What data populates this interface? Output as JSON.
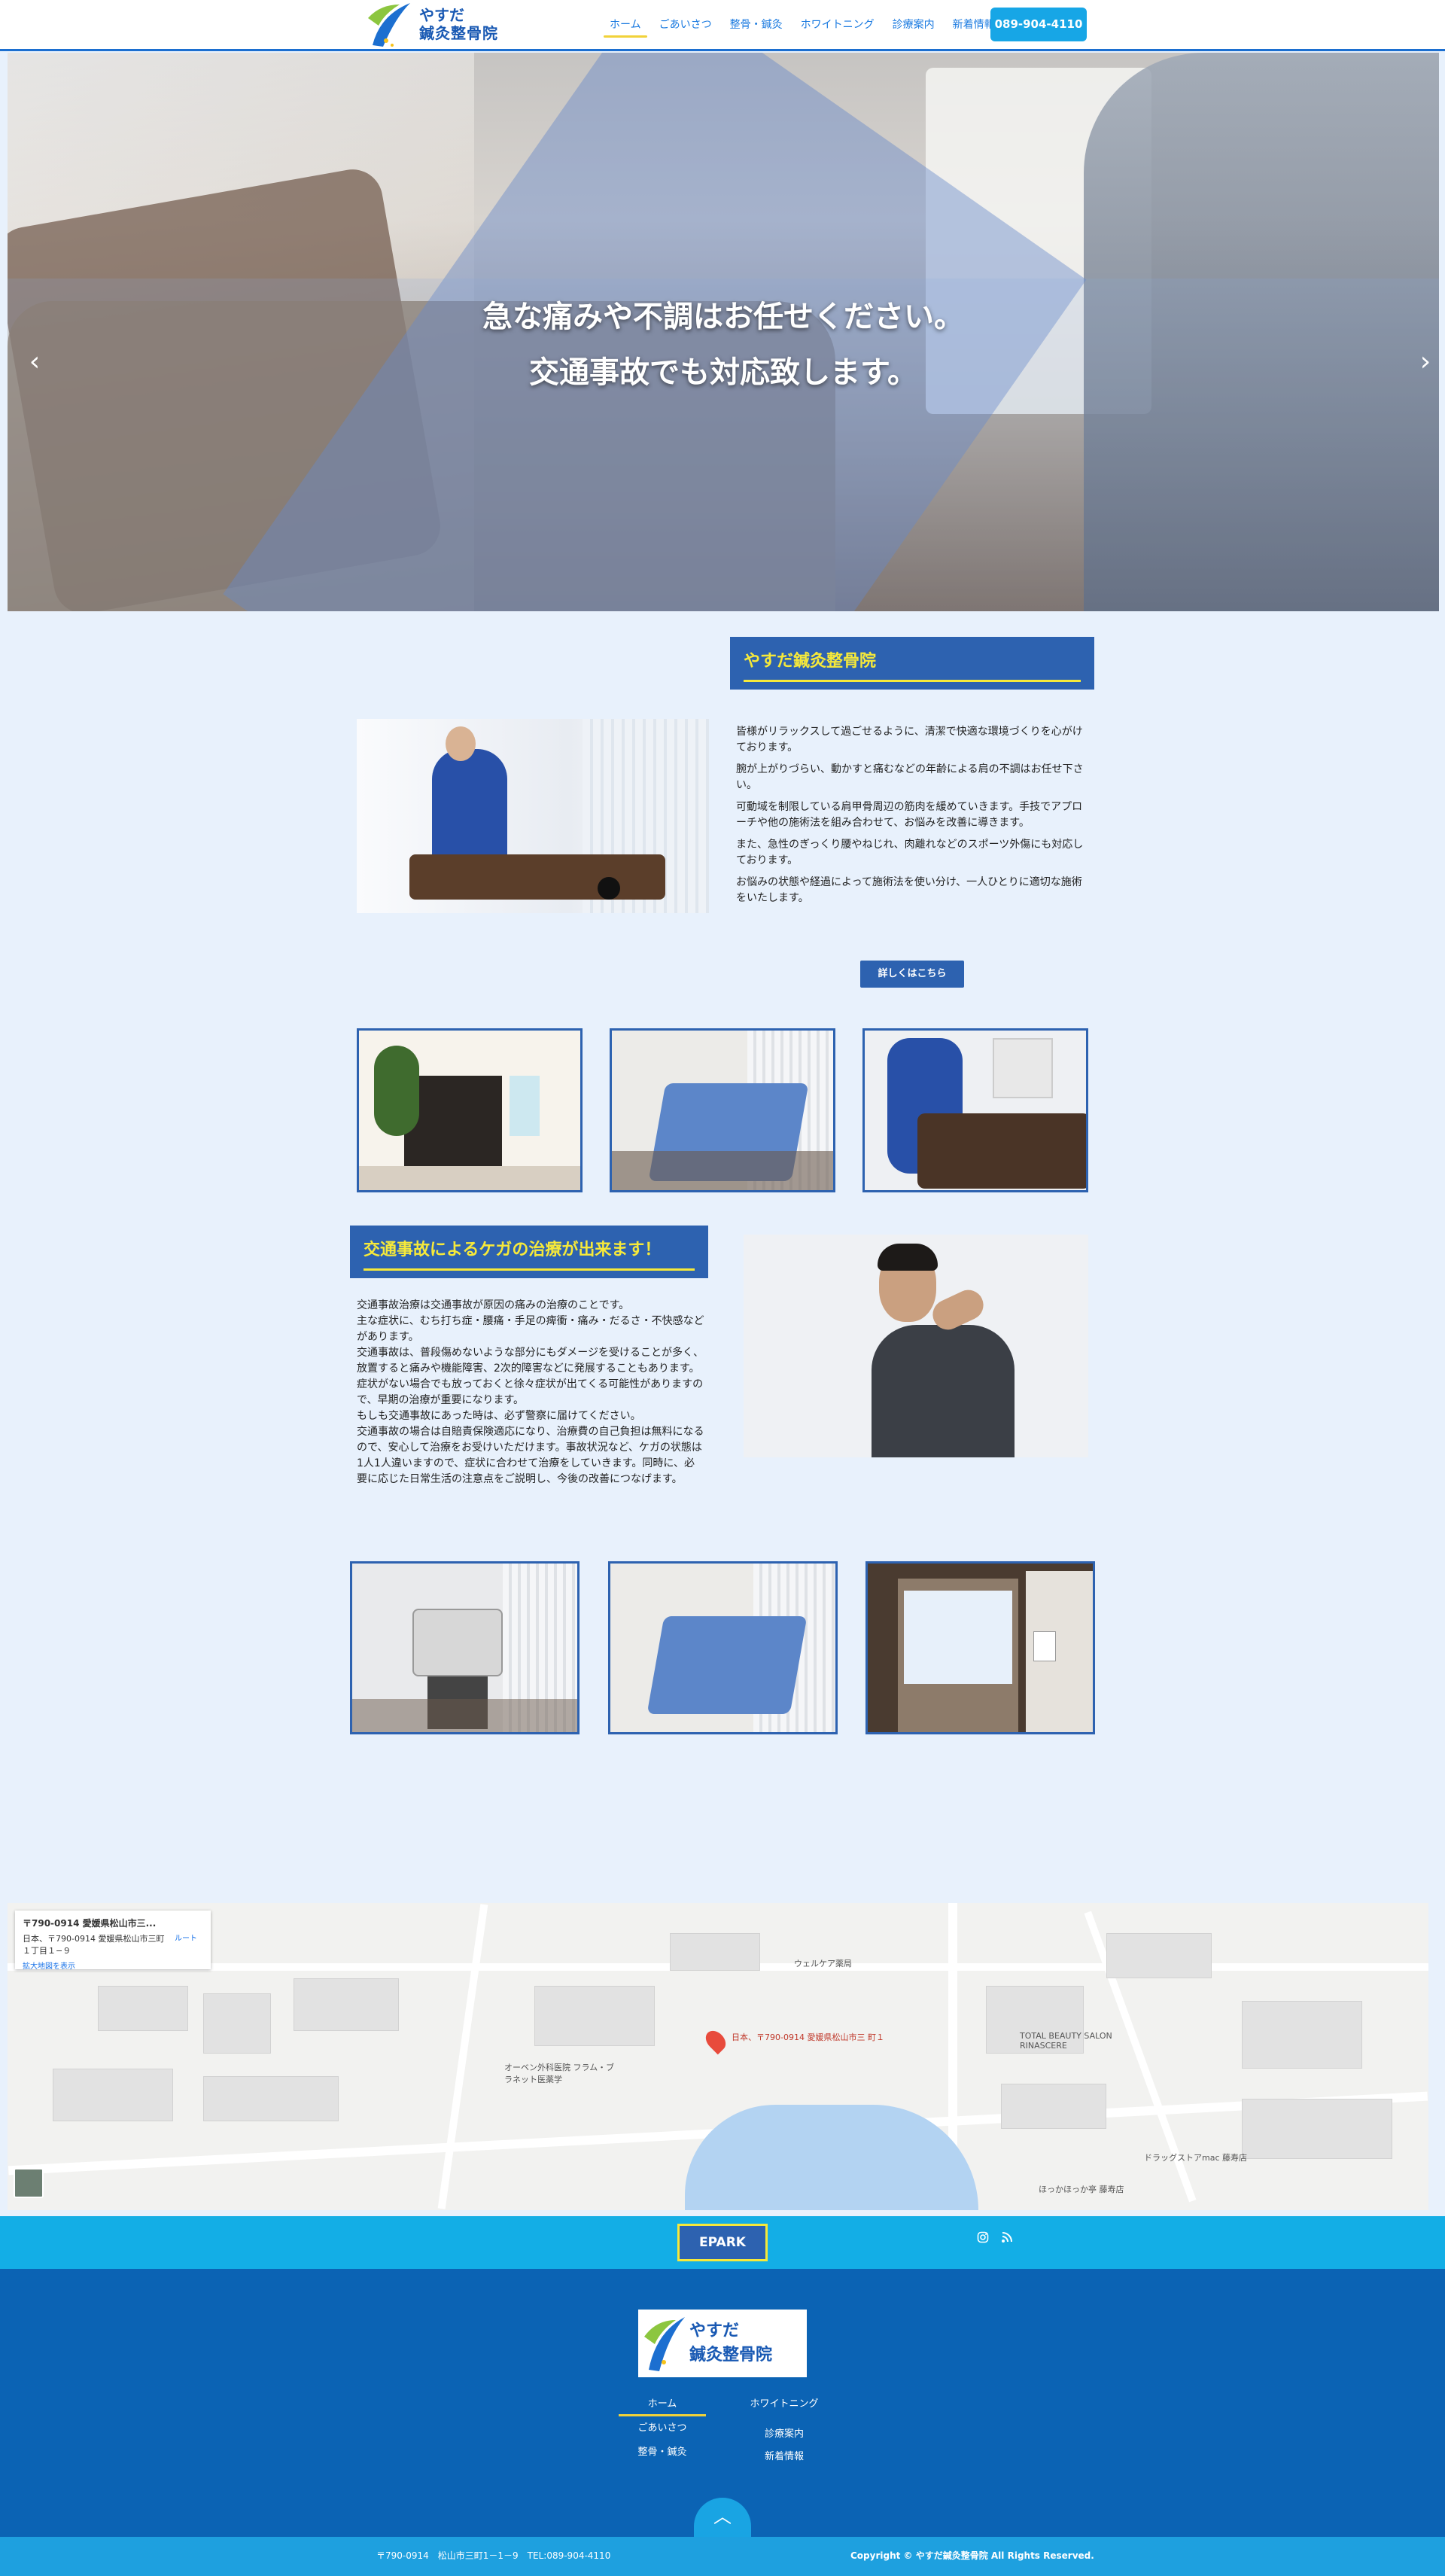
{
  "header": {
    "logo": {
      "line1": "やすだ",
      "line2": "鍼灸整骨院"
    },
    "nav": [
      {
        "label": "ホーム"
      },
      {
        "label": "ごあいさつ"
      },
      {
        "label": "整骨・鍼灸"
      },
      {
        "label": "ホワイトニング"
      },
      {
        "label": "診療案内"
      },
      {
        "label": "新着情報"
      }
    ],
    "phone": "089-904-4110"
  },
  "hero": {
    "line1": "急な痛みや不調はお任せください。",
    "line2": "交通事故でも対応致します。"
  },
  "intro": {
    "title": "やすだ鍼灸整骨院",
    "paragraphs": [
      "皆様がリラックスして過ごせるように、清潔で快適な環境づくりを心がけております。",
      "腕が上がりづらい、動かすと痛むなどの年齢による肩の不調はお任せ下さい。",
      "可動域を制限している肩甲骨周辺の筋肉を緩めていきます。手技でアプローチや他の施術法を組み合わせて、お悩みを改善に導きます。",
      "また、急性のぎっくり腰やねじれ、肉離れなどのスポーツ外傷にも対応しております。",
      "お悩みの状態や経過によって施術法を使い分け、一人ひとりに適切な施術をいたします。"
    ],
    "button": "詳しくはこちら"
  },
  "accident": {
    "title": "交通事故によるケガの治療が出来ます！",
    "lines": [
      "交通事故治療は交通事故が原因の痛みの治療のことです。",
      "主な症状に、むち打ち症・腰痛・手足の痺衝・痛み・だるさ・不快感などがあります。",
      "交通事故は、普段傷めないような部分にもダメージを受けることが多く、放置すると痛みや機能障害、2次的障害などに発展することもあります。",
      "症状がない場合でも放っておくと徐々症状が出てくる可能性がありますので、早期の治療が重要になります。",
      "もしも交通事故にあった時は、必ず警察に届けてください。",
      "交通事故の場合は自賠責保険適応になり、治療費の自己負担は無料になるので、安心して治療をお受けいただけます。事故状況など、ケガの状態は1人1人違いますので、症状に合わせて治療をしていきます。同時に、必要に応じた日常生活の注意点をご説明し、今後の改善につなげます。"
    ]
  },
  "map": {
    "card_title": "〒790-0914 愛媛県松山市三...",
    "card_address": "日本、〒790-0914 愛媛県松山市三町１丁目１−９",
    "card_route": "ルート",
    "card_link": "拡大地図を表示",
    "labels": [
      "ウェルケア薬局",
      "TOTAL BEAUTY SALON RINASCERE",
      "オーベン外科医院 フラム・ブラネット医薬学",
      "ドラッグストアmac 藤寿店",
      "ほっかほっか亭 藤寿店",
      "日本、〒790-0914 愛媛県松山市三 町１"
    ]
  },
  "cyan": {
    "epark": "EPARK",
    "instagram_icon": "instagram-icon",
    "rss_icon": "rss-icon"
  },
  "footer": {
    "logo": "やすだ\n鍼灸整骨院",
    "nav": [
      "ホーム",
      "ごあいさつ",
      "整骨・鍼灸",
      "ホワイトニング",
      "診療案内",
      "新着情報"
    ],
    "address": "〒790-0914　松山市三町1－1－9　TEL:089-904-4110",
    "copyright": "Copyright ©  やすだ鍼灸整骨院 All Rights Reserved."
  },
  "colors": {
    "accent": "#2d62b0",
    "yellow": "#f6e93a",
    "cyan": "#13aee6",
    "footer": "#0b63b4"
  }
}
